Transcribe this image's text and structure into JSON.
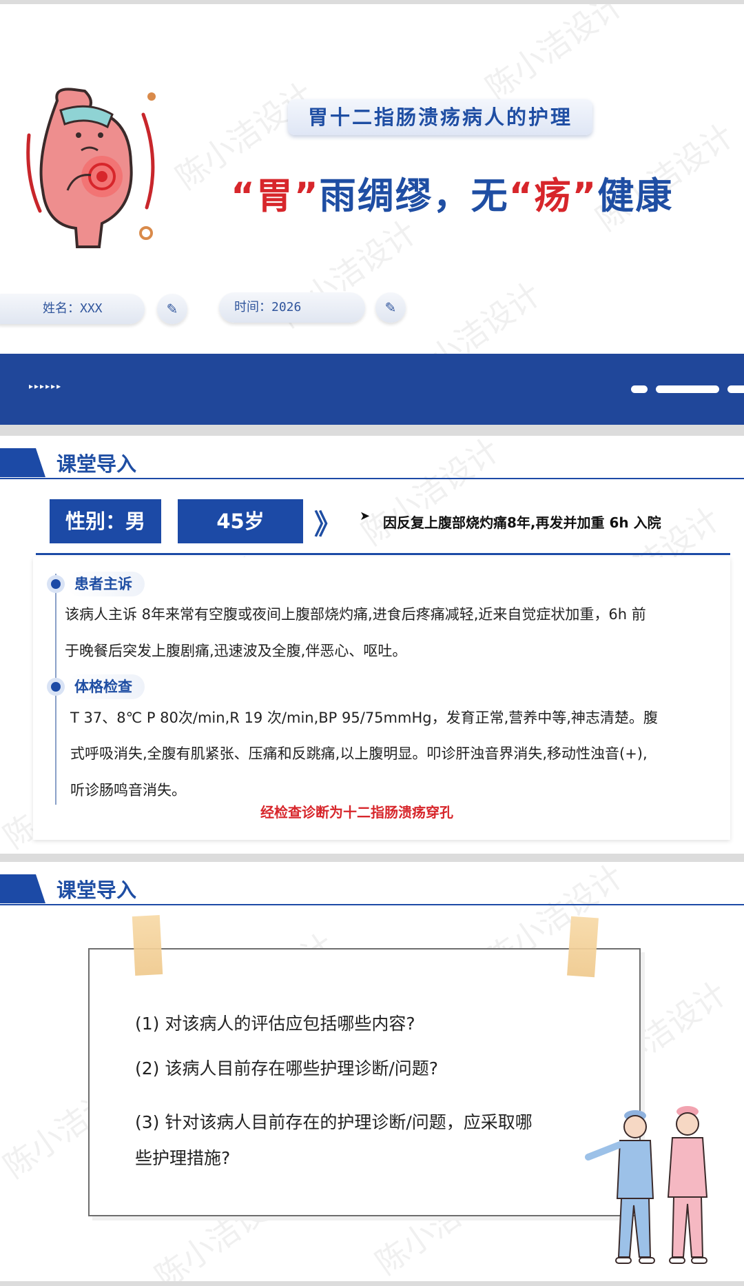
{
  "slide1": {
    "subtitle": "胃十二指肠溃疡病人的护理",
    "title_parts": [
      "“胃”",
      "雨绸缪，无",
      "“疡”",
      "健康"
    ],
    "name_label": "姓名：XXX",
    "time_label": "时间：2026",
    "dots": "▸▸▸▸▸▸"
  },
  "slide2": {
    "section_title": "课堂导入",
    "gender": "性别：男",
    "age": "45岁",
    "arrow_glyph": "》",
    "triangle": "➤",
    "chief_complaint": "因反复上腹部烧灼痛8年,再发并加重 6h 入院",
    "complaint_label": "患者主诉",
    "complaint_lines": [
      "该病人主诉 8年来常有空腹或夜间上腹部烧灼痛,进食后疼痛减轻,近来自觉症状加重，6h 前",
      "于晚餐后突发上腹剧痛,迅速波及全腹,伴恶心、呕吐。"
    ],
    "exam_label": "体格检查",
    "exam_lines": [
      "T 37、8℃ P 80次/min,R 19 次/min,BP 95/75mmHg，发育正常,营养中等,神志清楚。腹",
      "式呼吸消失,全腹有肌紧张、压痛和反跳痛,以上腹明显。叩诊肝浊音界消失,移动性浊音(+),",
      "听诊肠鸣音消失。"
    ],
    "diagnosis": "经检查诊断为十二指肠溃疡穿孔"
  },
  "slide3": {
    "section_title": "课堂导入",
    "questions": [
      "(1) 对该病人的评估应包括哪些内容?",
      "(2) 该病人目前存在哪些护理诊断/问题?",
      "(3) 针对该病人目前存在的护理诊断/问题，应采取哪",
      "些护理措施?"
    ]
  },
  "watermark": "陈小洁设计",
  "colors": {
    "brand_blue": "#1f4ea3",
    "accent_red": "#d7262b",
    "band_blue": "#20479a"
  }
}
